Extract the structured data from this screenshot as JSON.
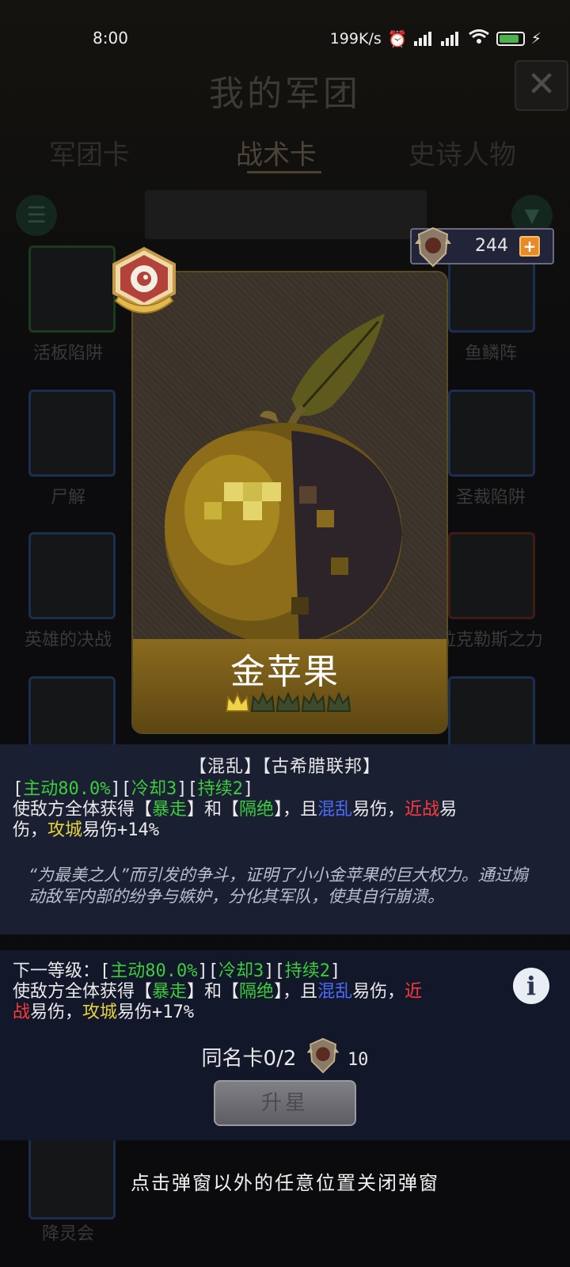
{
  "status_bar": {
    "time": "8:00",
    "net_speed": "199K/s",
    "battery": "85"
  },
  "header": {
    "title": "我的军团",
    "close_icon": "close-icon"
  },
  "tabs": [
    {
      "label": "军团卡"
    },
    {
      "label": "战术卡"
    },
    {
      "label": "史诗人物"
    }
  ],
  "background_cards": [
    {
      "label": "活板陷阱"
    },
    {
      "label": "鱼鳞阵"
    },
    {
      "label": "尸解"
    },
    {
      "label": "圣裁陷阱"
    },
    {
      "label": "英雄的决战"
    },
    {
      "label": "拉克勒斯之力"
    },
    {
      "label": "降灵会"
    }
  ],
  "currency": {
    "value": "244",
    "plus": "+"
  },
  "card": {
    "name": "金苹果",
    "stars_filled": 1,
    "stars_total": 5,
    "colors": {
      "band": "#8a6a1e",
      "crown_filled": "#f0d24a",
      "crown_empty": "#3d4a2c"
    }
  },
  "detail": {
    "tags": "【混乱】【古希腊联邦】",
    "current": {
      "line1": {
        "b1": "[",
        "active": "主动80.0%",
        "b2": "][",
        "cooldown": "冷却3",
        "b3": "][",
        "duration": "持续2",
        "b4": "]"
      },
      "line2": {
        "t1": "使敌方全体获得【",
        "rage": "暴走",
        "t2": "】和【",
        "isolate": "隔绝",
        "t3": "】，且",
        "chaos": "混乱",
        "t4": "易伤，",
        "melee": "近战",
        "t5": "易"
      },
      "line3": {
        "t1": "伤，",
        "siege": "攻城",
        "t2": "易伤+14%"
      }
    },
    "flavor": "“为最美之人”而引发的争斗，证明了小小金苹果的巨大权力。通过煽动敌军内部的纷争与嫉妒，分化其军队，使其自行崩溃。",
    "next_level": {
      "line1": {
        "prefix": "下一等级：[",
        "active": "主动80.0%",
        "b2": "][",
        "cooldown": "冷却3",
        "b3": "][",
        "duration": "持续2",
        "b4": "]"
      },
      "line2": {
        "t1": "使敌方全体获得【",
        "rage": "暴走",
        "t2": "】和【",
        "isolate": "隔绝",
        "t3": "】，且",
        "chaos": "混乱",
        "t4": "易伤，",
        "melee": "近"
      },
      "line3": {
        "melee2": "战",
        "t1": "易伤，",
        "siege": "攻城",
        "t2": "易伤+17%"
      }
    },
    "duplicates": {
      "label": "同名卡0/2",
      "cost": "10"
    },
    "upgrade_label": "升星",
    "info_icon": "info-icon"
  },
  "hint": "点击弹窗以外的任意位置关闭弹窗"
}
